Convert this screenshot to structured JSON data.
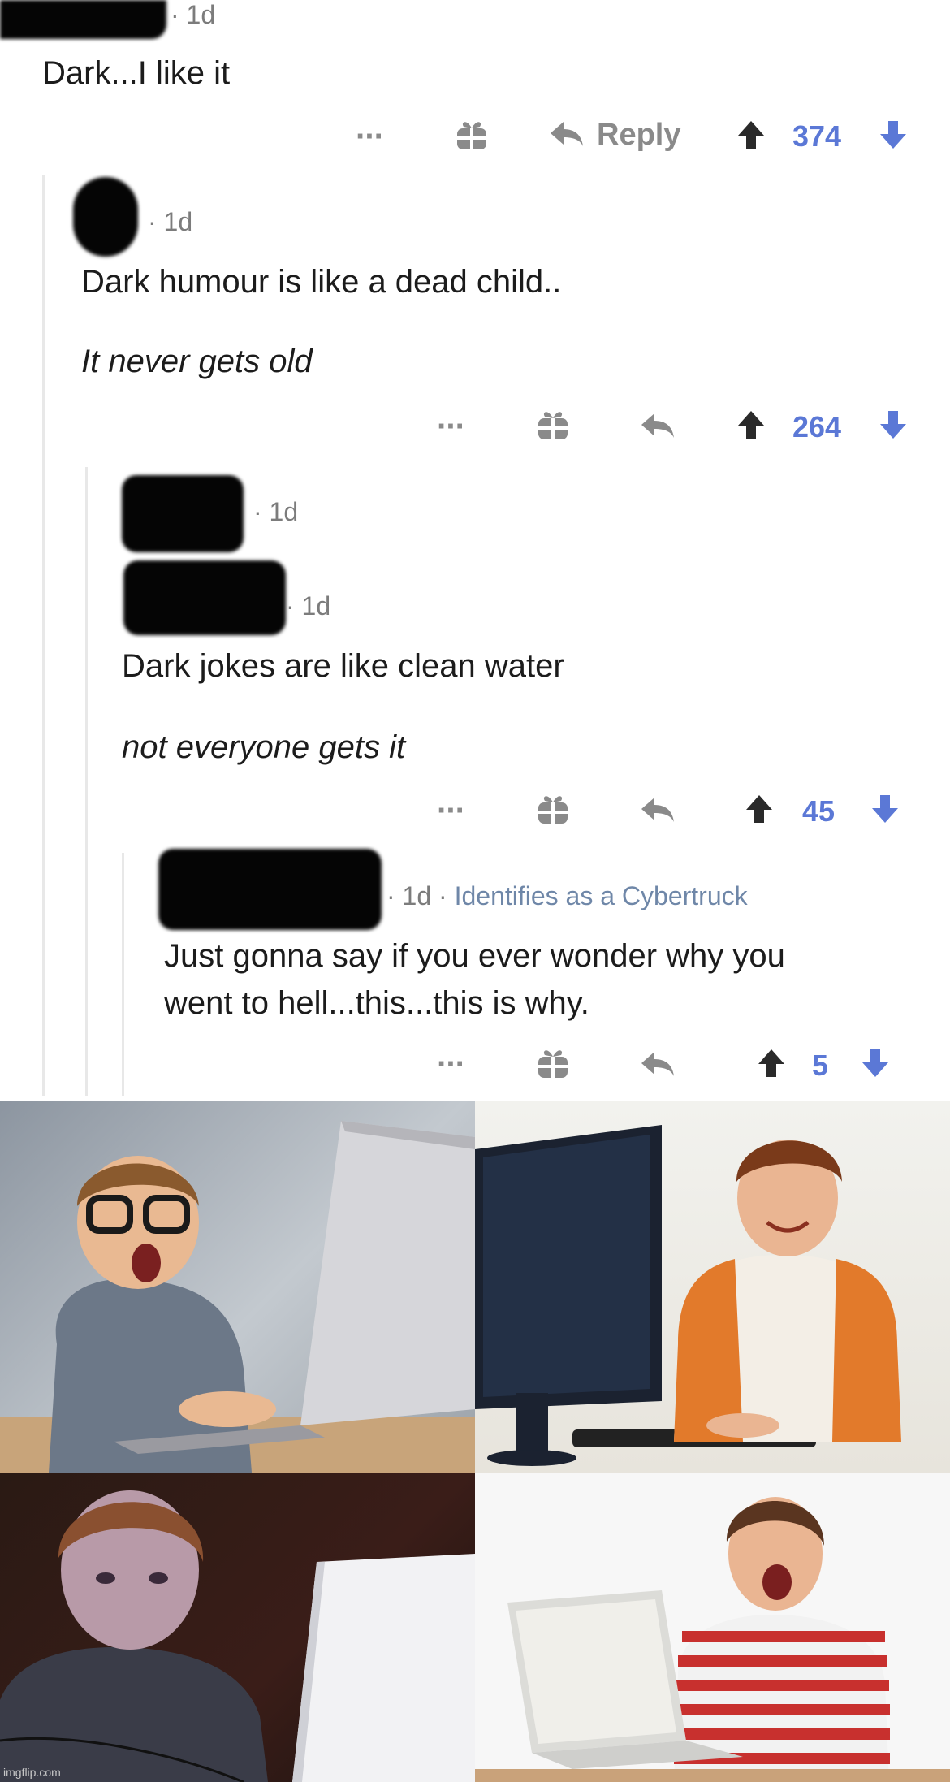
{
  "comments": [
    {
      "meta": "· 1d",
      "lines": [
        "Dark...I like it"
      ],
      "actions": {
        "more": "···",
        "reply": "Reply",
        "score": "374"
      }
    },
    {
      "meta": "· 1d",
      "lines": [
        "Dark humour is like a dead child..",
        "It never gets old"
      ],
      "actions": {
        "more": "···",
        "score": "264"
      }
    },
    {
      "meta_collapsed": "· 1d",
      "meta": "· 1d",
      "lines": [
        "Dark jokes are like clean water",
        "not everyone gets it"
      ],
      "actions": {
        "more": "···",
        "score": "45"
      }
    },
    {
      "meta": "· 1d ·",
      "flair": "Identifies as a Cybertruck",
      "lines": [
        "Just gonna say if you ever wonder why you",
        "went to hell...this...this is why."
      ],
      "actions": {
        "more": "···",
        "score": "5"
      }
    }
  ],
  "meme": {
    "panels": [
      "shocked-kid-glasses-laptop",
      "smiling-kid-desktop",
      "kid-glowing-screen-night",
      "excited-kid-striped-shirt"
    ]
  },
  "watermark": "imgflip.com",
  "colors": {
    "upvote": "#2a2a2a",
    "downvote": "#5b78d6",
    "score": "#5b78d6",
    "flair": "#6f87a8"
  }
}
